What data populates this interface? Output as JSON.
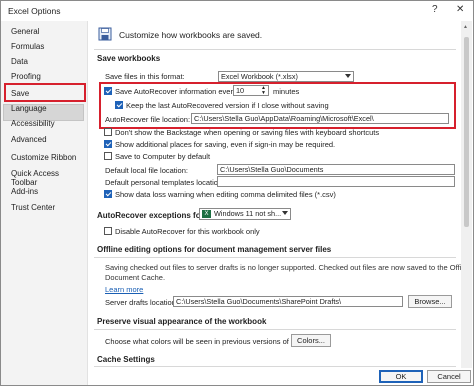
{
  "window": {
    "title": "Excel Options",
    "help_glyph": "?",
    "close_glyph": "✕"
  },
  "sidebar": {
    "items": [
      {
        "label": "General"
      },
      {
        "label": "Formulas"
      },
      {
        "label": "Data"
      },
      {
        "label": "Proofing"
      },
      {
        "label": "Save"
      },
      {
        "label": "Language"
      },
      {
        "label": "Accessibility"
      },
      {
        "label": "Advanced"
      },
      {
        "label": "Customize Ribbon"
      },
      {
        "label": "Quick Access Toolbar"
      },
      {
        "label": "Add-ins"
      },
      {
        "label": "Trust Center"
      }
    ],
    "selected": "Save"
  },
  "main": {
    "header_text": "Customize how workbooks are saved.",
    "save_workbooks": {
      "section_title": "Save workbooks",
      "format_label": "Save files in this format:",
      "format_value": "Excel Workbook (*.xlsx)",
      "autorecover_label": "Save AutoRecover information every",
      "autorecover_checked": true,
      "autorecover_minutes": "10",
      "minutes_label": "minutes",
      "keep_last_label": "Keep the last AutoRecovered version if I close without saving",
      "keep_last_checked": true,
      "autorecover_location_label": "AutoRecover file location:",
      "autorecover_location_value": "C:\\Users\\Stella Guo\\AppData\\Roaming\\Microsoft\\Excel\\",
      "dont_show_backstage_label": "Don't show the Backstage when opening or saving files with keyboard shortcuts",
      "dont_show_backstage_checked": false,
      "show_additional_places_label": "Show additional places for saving, even if sign-in may be required.",
      "show_additional_places_checked": true,
      "save_to_computer_label": "Save to Computer by default",
      "save_to_computer_checked": false,
      "default_local_label": "Default local file location:",
      "default_local_value": "C:\\Users\\Stella Guo\\Documents",
      "default_templates_label": "Default personal templates location:",
      "default_templates_value": "",
      "show_data_loss_label": "Show data loss warning when editing comma delimited files (*.csv)",
      "show_data_loss_checked": true
    },
    "autorecover_exceptions": {
      "label": "AutoRecover exceptions for:",
      "workbook_value": "Windows 11 not sh...",
      "disable_label": "Disable AutoRecover for this workbook only",
      "disable_checked": false
    },
    "offline": {
      "section_title": "Offline editing options for document management server files",
      "info_line1": "Saving checked out files to server drafts is no longer supported. Checked out files are now saved to the Office",
      "info_line2": "Document Cache.",
      "learn_more": "Learn more",
      "server_drafts_label": "Server drafts location:",
      "server_drafts_value": "C:\\Users\\Stella Guo\\Documents\\SharePoint Drafts\\",
      "browse_label": "Browse..."
    },
    "preserve": {
      "section_title": "Preserve visual appearance of the workbook",
      "colors_text": "Choose what colors will be seen in previous versions of Excel:",
      "colors_button": "Colors..."
    },
    "cache": {
      "section_title": "Cache Settings"
    }
  },
  "footer": {
    "ok_label": "OK",
    "cancel_label": "Cancel"
  },
  "colors": {
    "highlight_box": "#d6202d",
    "accent": "#1e62b8",
    "excel_green": "#1d6f42"
  }
}
